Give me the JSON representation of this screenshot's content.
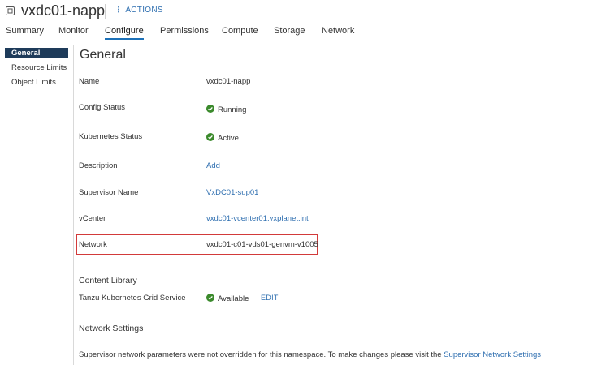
{
  "header": {
    "title": "vxdc01-napp",
    "actions_label": "ACTIONS"
  },
  "tabs": [
    {
      "label": "Summary"
    },
    {
      "label": "Monitor"
    },
    {
      "label": "Configure",
      "active": true
    },
    {
      "label": "Permissions"
    },
    {
      "label": "Compute"
    },
    {
      "label": "Storage"
    },
    {
      "label": "Network"
    }
  ],
  "sidebar": {
    "items": [
      {
        "label": "General",
        "active": true
      },
      {
        "label": "Resource Limits"
      },
      {
        "label": "Object Limits"
      }
    ]
  },
  "main": {
    "title": "General",
    "rows": [
      {
        "label": "Name",
        "value": "vxdc01-napp"
      },
      {
        "label": "Config Status",
        "value": "Running"
      },
      {
        "label": "Kubernetes Status",
        "value": "Active"
      },
      {
        "label": "Description",
        "value": "Add"
      },
      {
        "label": "Supervisor Name",
        "value": "VxDC01-sup01"
      },
      {
        "label": "vCenter",
        "value": "vxdc01-vcenter01.vxplanet.int"
      },
      {
        "label": "Network",
        "value": "vxdc01-c01-vds01-genvm-v1005"
      }
    ],
    "content_library": {
      "heading": "Content Library",
      "label": "Tanzu Kubernetes Grid Service",
      "status": "Available",
      "edit_label": "EDIT"
    },
    "network_settings": {
      "heading": "Network Settings",
      "note": "Supervisor network parameters were not overridden for this namespace. To make changes please visit the",
      "link": "Supervisor Network Settings"
    }
  },
  "colors": {
    "accent": "#1d71b8",
    "link": "#2f6fb0",
    "success": "#3b8a2c",
    "highlight": "#d23a3a",
    "sidebar_active": "#1e3b5a"
  }
}
